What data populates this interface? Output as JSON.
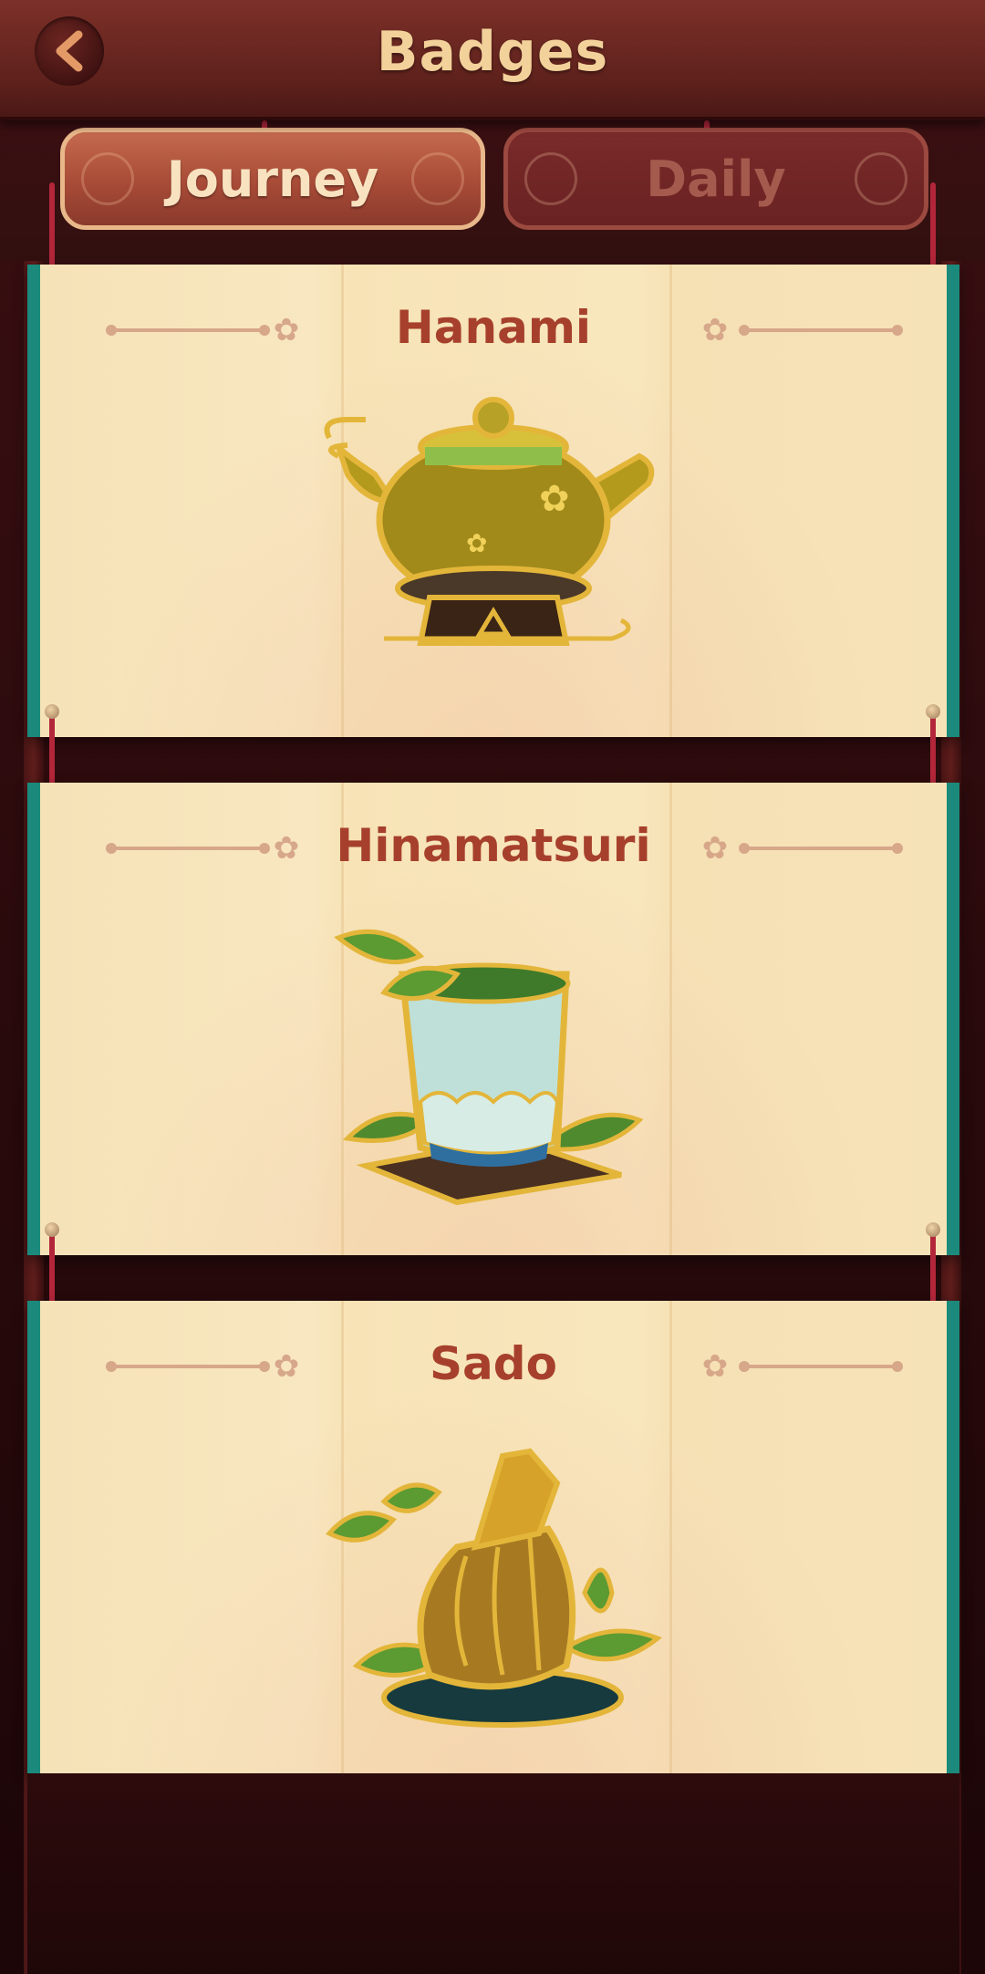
{
  "header": {
    "title": "Badges",
    "back_icon": "chevron-left-icon"
  },
  "tabs": [
    {
      "label": "Journey",
      "active": true
    },
    {
      "label": "Daily",
      "active": false
    }
  ],
  "badges": [
    {
      "title": "Hanami",
      "icon": "teapot-badge-icon"
    },
    {
      "title": "Hinamatsuri",
      "icon": "tea-cup-badge-icon"
    },
    {
      "title": "Sado",
      "icon": "tea-whisk-badge-icon"
    }
  ],
  "colors": {
    "accent": "#a6402c",
    "teal_border": "#1b8a7c",
    "header_title": "#f3d19a"
  }
}
